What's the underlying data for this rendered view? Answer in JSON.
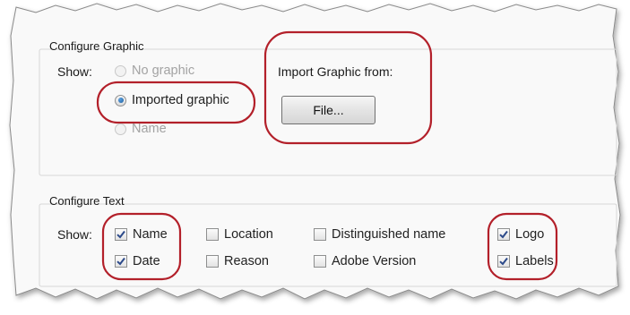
{
  "configure_graphic": {
    "title": "Configure Graphic",
    "show_label": "Show:",
    "options": [
      {
        "label": "No graphic",
        "selected": false,
        "enabled": false
      },
      {
        "label": "Imported graphic",
        "selected": true,
        "enabled": true
      },
      {
        "label": "Name",
        "selected": false,
        "enabled": false
      }
    ],
    "import_label": "Import Graphic from:",
    "file_button": "File..."
  },
  "configure_text": {
    "title": "Configure Text",
    "show_label": "Show:",
    "checkboxes": [
      {
        "label": "Name",
        "checked": true
      },
      {
        "label": "Date",
        "checked": true
      },
      {
        "label": "Location",
        "checked": false
      },
      {
        "label": "Reason",
        "checked": false
      },
      {
        "label": "Distinguished name",
        "checked": false
      },
      {
        "label": "Adobe Version",
        "checked": false
      },
      {
        "label": "Logo",
        "checked": true
      },
      {
        "label": "Labels",
        "checked": true
      }
    ]
  },
  "colors": {
    "highlight": "#b3202a",
    "check": "#2c4a8a",
    "radio_selected": "#1f5f9e"
  }
}
